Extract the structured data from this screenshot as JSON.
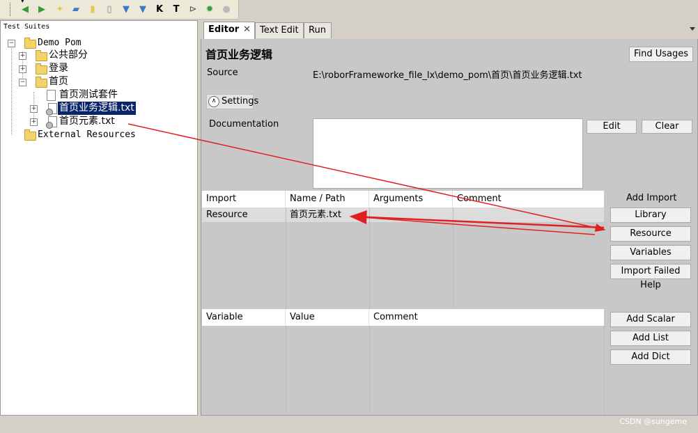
{
  "toolbar": {
    "icons": [
      "back-arrow-icon",
      "forward-arrow-icon",
      "new-project-icon",
      "open-folder-icon",
      "new-suite-icon",
      "new-file-icon",
      "save-icon",
      "save-all-icon",
      "keyword-search-icon",
      "text-search-icon",
      "run-icon",
      "debug-bug-icon",
      "stop-icon"
    ]
  },
  "left": {
    "title": "Test Suites",
    "tree": [
      {
        "label": "Demo Pom",
        "level": 0
      },
      {
        "label": "公共部分",
        "level": 1
      },
      {
        "label": "登录",
        "level": 1
      },
      {
        "label": "首页",
        "level": 1
      },
      {
        "label": "首页测试套件",
        "level": 2
      },
      {
        "label": "首页业务逻辑.txt",
        "level": 2,
        "selected": true
      },
      {
        "label": "首页元素.txt",
        "level": 2
      },
      {
        "label": "External Resources",
        "level": 0
      }
    ]
  },
  "tabs": [
    {
      "label": "Editor",
      "active": true
    },
    {
      "label": "Text Edit"
    },
    {
      "label": "Run"
    }
  ],
  "editor": {
    "title": "首页业务逻辑",
    "find_usages": "Find Usages",
    "source_label": "Source",
    "source_value": "E:\\roborFrameworke_file_lx\\demo_pom\\首页\\首页业务逻辑.txt",
    "settings_label": "Settings",
    "documentation_label": "Documentation",
    "edit_button": "Edit",
    "clear_button": "Clear",
    "import_table": {
      "headers": [
        "Import",
        "Name / Path",
        "Arguments",
        "Comment"
      ],
      "rows": [
        [
          "Resource",
          "首页元素.txt",
          "",
          ""
        ]
      ]
    },
    "add_import_label": "Add Import",
    "import_buttons": [
      "Library",
      "Resource",
      "Variables",
      "Import Failed Help"
    ],
    "variable_table": {
      "headers": [
        "Variable",
        "Value",
        "Comment"
      ]
    },
    "variable_buttons": [
      "Add Scalar",
      "Add List",
      "Add Dict"
    ]
  },
  "watermark": "CSDN @sungeme",
  "colors": {
    "annotation_arrow": "#e02020",
    "selection": "#0a246a"
  }
}
